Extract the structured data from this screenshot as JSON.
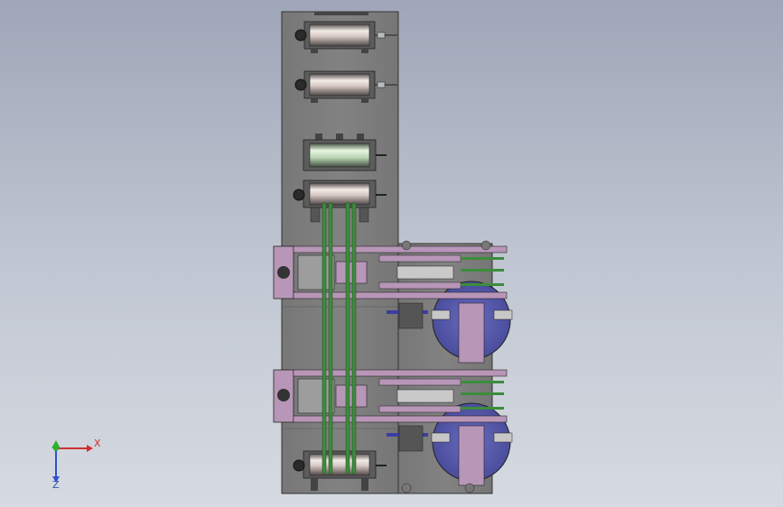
{
  "view": {
    "background_top": "#9ea6b8",
    "background_bottom": "#d6dae1"
  },
  "colors": {
    "frame": "#7c7c7c",
    "frame_edge": "#3a3a3a",
    "bracket": "#b896b8",
    "belt": "#3c8c3c",
    "disc": "#5b5eb0",
    "roller_light": "#ece4e0",
    "roller_dark": "#6f6868",
    "roller_green": "#cfe8c8"
  },
  "orientation_triad": {
    "x_label": "X",
    "z_label": "Z",
    "x_color": "#d03030",
    "y_color": "#30b030",
    "z_color": "#3050d0"
  },
  "components": {
    "rollers": [
      "unwind-roller-1",
      "unwind-roller-2",
      "guide-roller-1",
      "guide-roller-2",
      "rewind-roller"
    ],
    "stations": [
      "conveyor-station-upper",
      "conveyor-station-lower"
    ],
    "discs": [
      "rotary-disc-upper",
      "rotary-disc-lower"
    ]
  }
}
